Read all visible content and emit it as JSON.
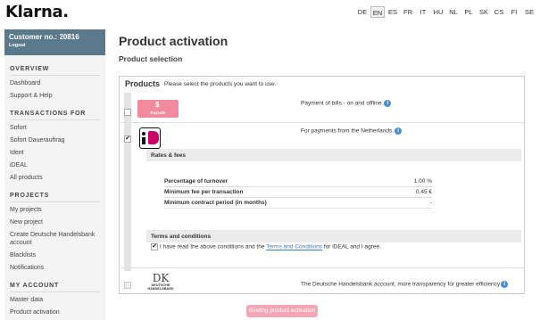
{
  "header": {
    "logo": "Klarna.",
    "languages": [
      "DE",
      "EN",
      "ES",
      "FR",
      "IT",
      "HU",
      "NL",
      "PL",
      "SK",
      "CS",
      "FI",
      "SE"
    ],
    "active_language": "EN"
  },
  "sidebar": {
    "customer_no": "Customer no.: 20816",
    "logout": "Logout",
    "sections": [
      {
        "title": "OVERVIEW",
        "items": [
          "Dashboard",
          "Support & Help"
        ]
      },
      {
        "title": "TRANSACTIONS FOR",
        "items": [
          "Sofort",
          "Sofort Dauerauftrag",
          "Ident",
          "iDEAL",
          "All products"
        ]
      },
      {
        "title": "PROJECTS",
        "items": [
          "My projects",
          "New project",
          "Create Deutsche Handelsbank account",
          "Blacklists",
          "Notifications"
        ]
      },
      {
        "title": "MY ACCOUNT",
        "items": [
          "Master data",
          "Product activation"
        ]
      }
    ]
  },
  "main": {
    "title": "Product activation",
    "subtitle": "Product selection",
    "products_label": "Products",
    "products_hint": "Please select the products you want to use.",
    "paysafe": {
      "logo_text": "Paysafe",
      "description": "Payment of bills - on and offline."
    },
    "ideal": {
      "description": "For payments from the Netherlands.",
      "checked": "✔",
      "rates_title": "Rates & fees",
      "rates": [
        {
          "label": "Percentage of turnover",
          "value": "1.00 %"
        },
        {
          "label": "Minimum fee per transaction",
          "value": "0.45 €"
        },
        {
          "label": "Minimum contract period (in months)",
          "value": "-"
        }
      ],
      "terms_title": "Terms and conditions",
      "terms_prefix": "I have read the above conditions and the ",
      "terms_link": "Terms and Conditions",
      "terms_suffix": " for iDEAL and I agree."
    },
    "dhb": {
      "logo_mark": "DK",
      "logo_text_1": "DEUTSCHE",
      "logo_text_2": "HANDELSBANK",
      "description": "The Deutsche Handelsbank account: more transparency for greater efficiency"
    },
    "submit_label": "Binding product activation"
  },
  "info_glyph": "i"
}
